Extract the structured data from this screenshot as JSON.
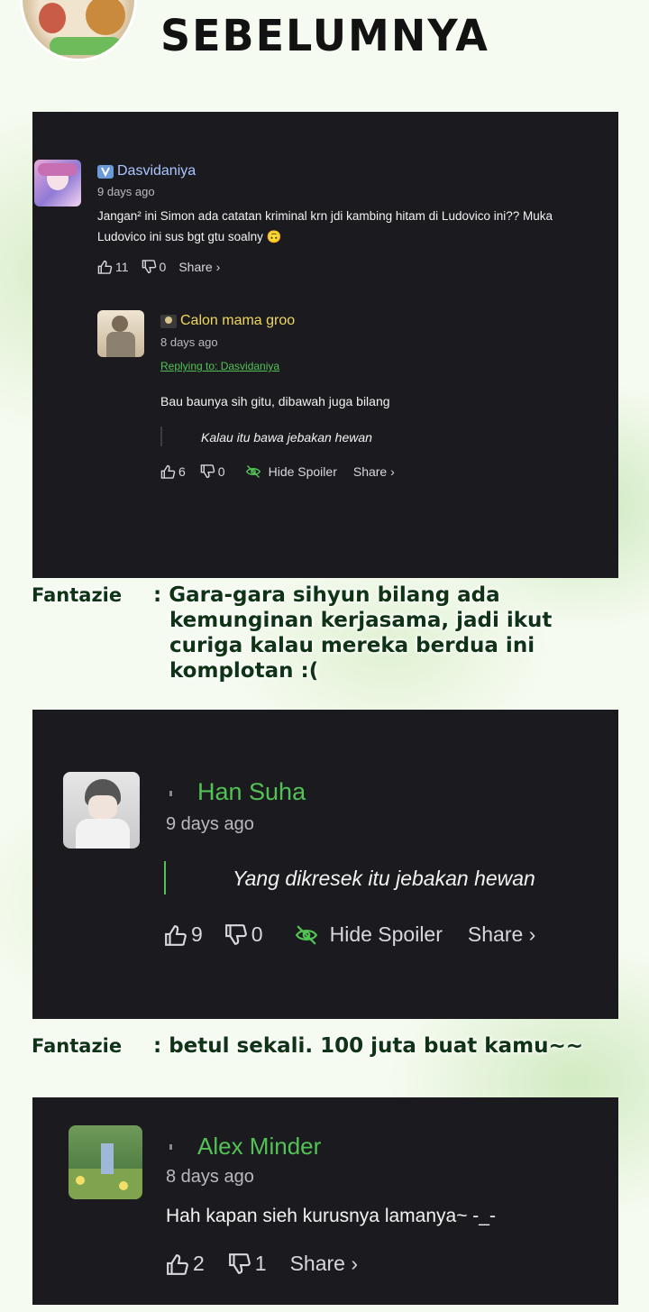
{
  "header": {
    "title": "SEBELUMNYA"
  },
  "card1": {
    "comment": {
      "username": "Dasvidaniya",
      "time": "9 days ago",
      "text_line1": "Jangan² ini Simon ada catatan kriminal krn jdi kambing hitam di Ludovico ini?? Muka",
      "text_line2": "Ludovico ini sus bgt gtu soalny 🙃",
      "likes": "11",
      "dislikes": "0",
      "share": "Share ›"
    },
    "reply": {
      "username": "Calon mama groo",
      "time": "8 days ago",
      "replying_to": "Replying to: Dasvidaniya",
      "text": "Bau baunya sih gitu, dibawah juga bilang",
      "spoiler": "Kalau itu bawa jebakan hewan",
      "likes": "6",
      "dislikes": "0",
      "hide_spoiler": "Hide Spoiler",
      "share": "Share ›"
    }
  },
  "note1": {
    "speaker": "Fantazie",
    "text_lines": [
      ": Gara-gara sihyun bilang ada",
      "kemunginan kerjasama, jadi ikut",
      "curiga kalau mereka berdua ini",
      "komplotan :("
    ]
  },
  "card2": {
    "username": "Han Suha",
    "time": "9 days ago",
    "spoiler": "Yang dikresek itu jebakan hewan",
    "likes": "9",
    "dislikes": "0",
    "hide_spoiler": "Hide Spoiler",
    "share": "Share ›"
  },
  "note2": {
    "speaker": "Fantazie",
    "text": ": betul sekali. 100 juta buat kamu~~"
  },
  "card3": {
    "username": "Alex Minder",
    "time": "8 days ago",
    "text": "Hah kapan sieh kurusnya lamanya~ -_-",
    "likes": "2",
    "dislikes": "1",
    "share": "Share ›"
  },
  "colors": {
    "accent_green": "#52c255",
    "card_bg": "#1b1b1f",
    "reply_name": "#f0d75a",
    "user_name": "#a9c7ff"
  },
  "icons": [
    "thumbs-up-icon",
    "thumbs-down-icon",
    "eye-off-icon",
    "badge-icon"
  ]
}
